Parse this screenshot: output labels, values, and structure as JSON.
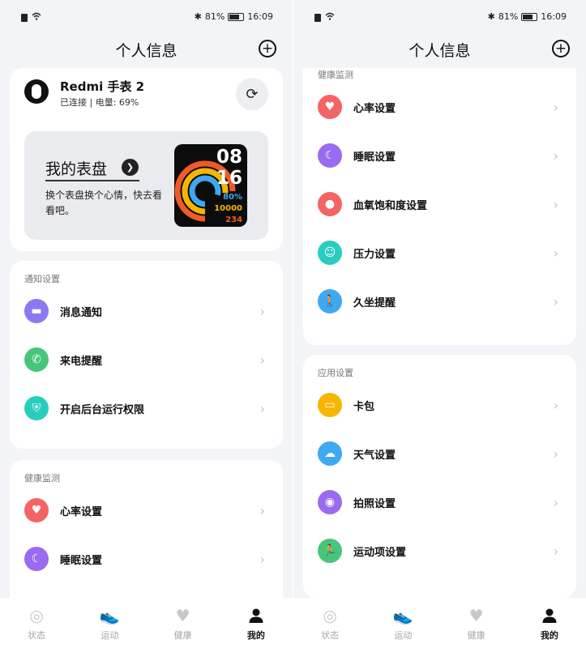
{
  "status_bar": {
    "battery": "81%",
    "time": "16:09"
  },
  "header": {
    "title": "个人信息"
  },
  "left": {
    "device": {
      "name": "Redmi 手表 2",
      "status": "已连接 | 电量: 69%",
      "watchface_title": "我的表盘",
      "watchface_desc": "换个表盘换个心情，快去看看吧。",
      "watch": {
        "hour": "08",
        "minute": "16",
        "stat1": "80%",
        "stat2": "10000",
        "stat3": "234"
      }
    },
    "notification": {
      "title": "通知设置",
      "items": [
        {
          "label": "消息通知",
          "icon": "message-icon",
          "color": "#8c79f2"
        },
        {
          "label": "来电提醒",
          "icon": "phone-icon",
          "color": "#46c67a"
        },
        {
          "label": "开启后台运行权限",
          "icon": "shield-icon",
          "color": "#28cdbf"
        }
      ]
    },
    "health": {
      "title": "健康监测",
      "items": [
        {
          "label": "心率设置",
          "icon": "heart-icon",
          "color": "#f46464"
        },
        {
          "label": "睡眠设置",
          "icon": "moon-icon",
          "color": "#9a6bf0"
        }
      ]
    }
  },
  "right": {
    "health": {
      "title": "健康监测",
      "items": [
        {
          "label": "心率设置",
          "icon": "heart-icon",
          "color": "#f46464"
        },
        {
          "label": "睡眠设置",
          "icon": "moon-icon",
          "color": "#9a6bf0"
        },
        {
          "label": "血氧饱和度设置",
          "icon": "blood-drop-icon",
          "color": "#f46464"
        },
        {
          "label": "压力设置",
          "icon": "smile-icon",
          "color": "#28cdbf"
        },
        {
          "label": "久坐提醒",
          "icon": "walk-icon",
          "color": "#3fa8f3"
        }
      ]
    },
    "apps": {
      "title": "应用设置",
      "items": [
        {
          "label": "卡包",
          "icon": "card-icon",
          "color": "#f7b500"
        },
        {
          "label": "天气设置",
          "icon": "weather-icon",
          "color": "#3fa8f3"
        },
        {
          "label": "拍照设置",
          "icon": "camera-icon",
          "color": "#9a6bf0"
        },
        {
          "label": "运动项设置",
          "icon": "run-icon",
          "color": "#46c67a"
        }
      ]
    }
  },
  "nav": {
    "items": [
      {
        "label": "状态",
        "icon": "status-ring-icon",
        "active": false
      },
      {
        "label": "运动",
        "icon": "shoe-icon",
        "active": false
      },
      {
        "label": "健康",
        "icon": "heart-icon",
        "active": false
      },
      {
        "label": "我的",
        "icon": "person-icon",
        "active": true
      }
    ]
  },
  "colors": {
    "background": "#f3f4f8",
    "card": "#ffffff",
    "active": "#111111",
    "inactive": "#a5a5a5"
  }
}
